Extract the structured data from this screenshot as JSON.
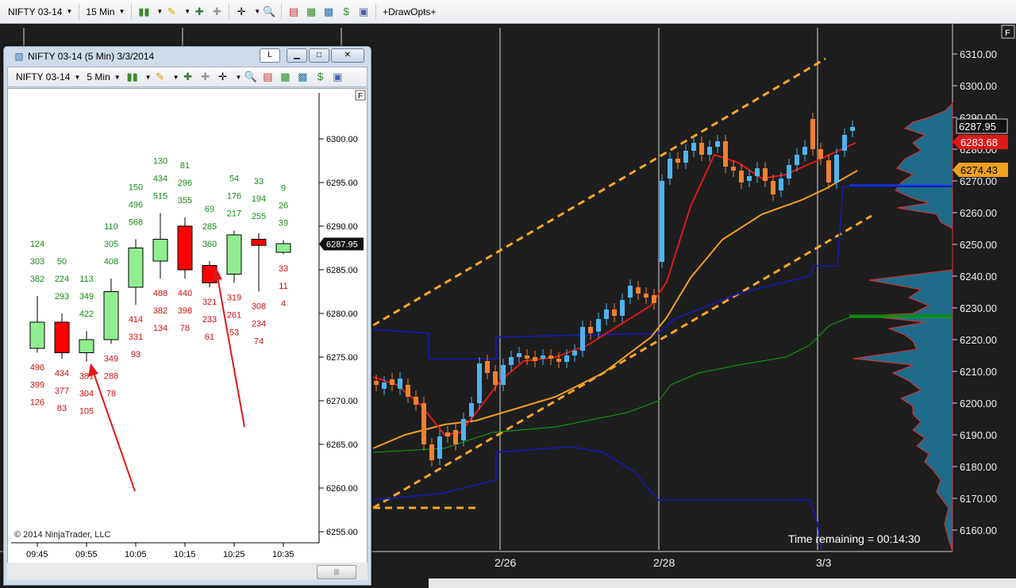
{
  "toolbar": {
    "instrument": "NIFTY 03-14",
    "interval": "15 Min",
    "draw_opts": "+DrawOpts+"
  },
  "main_chart": {
    "y_labels": [
      "6310.00",
      "6300.00",
      "6290.00",
      "6280.00",
      "6270.00",
      "6260.00",
      "6250.00",
      "6240.00",
      "6230.00",
      "6220.00",
      "6210.00",
      "6200.00",
      "6190.00",
      "6180.00",
      "6170.00",
      "6160.00"
    ],
    "date_labels": [
      "2/26",
      "2/28",
      "3/3"
    ],
    "price_tags": [
      "6287.95",
      "6283.68",
      "6274.43"
    ],
    "time_remaining": "Time remaining = 00:14:30",
    "f_button": "F",
    "colors": {
      "up": "#4fb3f0",
      "down": "#f08030",
      "channel": "#f5a623",
      "ema_fast": "#e01010",
      "ema_slow": "#f0a020",
      "blue_band": "#1010a0",
      "green_band": "#0a7a0a",
      "profile": "#1f6c8a"
    }
  },
  "sub_window": {
    "title": "NIFTY 03-14 (5 Min)  3/3/2014",
    "btn_l": "L",
    "toolbar": {
      "instrument": "NIFTY 03-14",
      "interval": "5 Min"
    },
    "y_labels": [
      "6300.00",
      "6295.00",
      "6290.00",
      "6285.00",
      "6280.00",
      "6275.00",
      "6270.00",
      "6265.00",
      "6260.00",
      "6255.00"
    ],
    "x_labels": [
      "09:45",
      "09:55",
      "10:05",
      "10:15",
      "10:25",
      "10:35"
    ],
    "price_tag": "6287.95",
    "copyright": "© 2014 NinjaTrader, LLC",
    "f_button": "F",
    "bars": [
      {
        "open": 6276,
        "close": 6279,
        "high": 6282,
        "low": 6275.5,
        "up": true,
        "ask": [
          "124",
          "303",
          "382"
        ],
        "bid": [
          "496",
          "399",
          "126"
        ]
      },
      {
        "open": 6279,
        "close": 6275.5,
        "high": 6280,
        "low": 6274.8,
        "up": false,
        "ask": [
          "50",
          "224",
          "293"
        ],
        "bid": [
          "434",
          "377",
          "83"
        ]
      },
      {
        "open": 6275.5,
        "close": 6277,
        "high": 6278,
        "low": 6274.5,
        "up": true,
        "ask": [
          "113",
          "349",
          "422"
        ],
        "bid": [
          "381",
          "304",
          "105"
        ]
      },
      {
        "open": 6277,
        "close": 6282.5,
        "high": 6284,
        "low": 6276.5,
        "up": true,
        "ask": [
          "110",
          "305",
          "408"
        ],
        "bid": [
          "349",
          "288",
          "78"
        ]
      },
      {
        "open": 6283,
        "close": 6287.5,
        "high": 6288.5,
        "low": 6281,
        "up": true,
        "ask": [
          "150",
          "496",
          "568"
        ],
        "bid": [
          "414",
          "331",
          "93"
        ]
      },
      {
        "open": 6286,
        "close": 6288.5,
        "high": 6291.5,
        "low": 6284,
        "up": true,
        "ask": [
          "130",
          "434",
          "515"
        ],
        "bid": [
          "488",
          "382",
          "134"
        ]
      },
      {
        "open": 6290,
        "close": 6285,
        "high": 6291,
        "low": 6284,
        "up": false,
        "ask": [
          "81",
          "296",
          "355"
        ],
        "bid": [
          "440",
          "398",
          "78"
        ]
      },
      {
        "open": 6285.5,
        "close": 6283.5,
        "high": 6286,
        "low": 6283,
        "up": false,
        "ask": [
          "69",
          "285",
          "360"
        ],
        "bid": [
          "321",
          "233",
          "61"
        ]
      },
      {
        "open": 6284.5,
        "close": 6289,
        "high": 6289.5,
        "low": 6283.5,
        "up": true,
        "ask": [
          "54",
          "176",
          "217"
        ],
        "bid": [
          "319",
          "261",
          "53"
        ]
      },
      {
        "open": 6288.5,
        "close": 6287.8,
        "high": 6289.2,
        "low": 6282.5,
        "up": false,
        "ask": [
          "33",
          "194",
          "255"
        ],
        "bid": [
          "308",
          "234",
          "74"
        ]
      },
      {
        "open": 6287,
        "close": 6288,
        "high": 6288.4,
        "low": 6286.8,
        "up": true,
        "ask": [
          "9",
          "26",
          "39"
        ],
        "bid": [
          "33",
          "11",
          "4"
        ]
      }
    ]
  }
}
